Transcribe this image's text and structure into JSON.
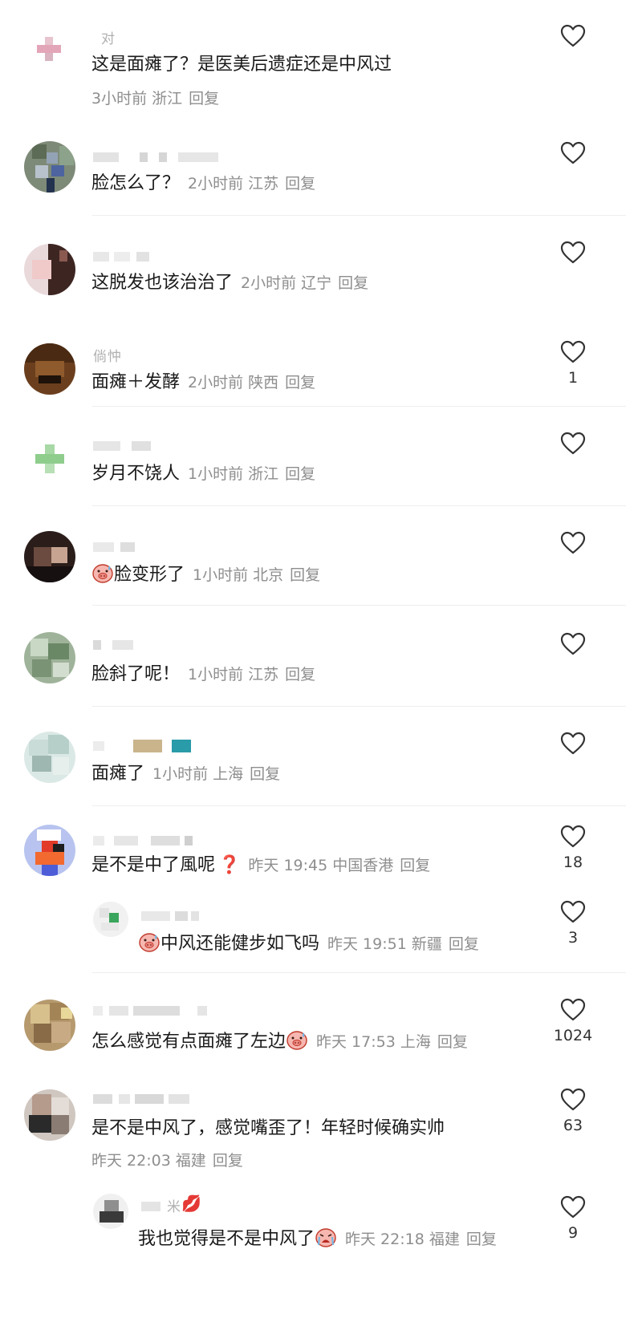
{
  "comments": [
    {
      "nick": "对",
      "text": "这是面瘫了？是医美后遗症还是中风过",
      "time": "3小时前",
      "region": "浙江",
      "reply": "回复",
      "likes": ""
    },
    {
      "nick": "",
      "text": "脸怎么了？",
      "time": "2小时前",
      "region": "江苏",
      "reply": "回复",
      "likes": ""
    },
    {
      "nick": "",
      "text": "这脱发也该治治了",
      "time": "2小时前",
      "region": "辽宁",
      "reply": "回复",
      "likes": ""
    },
    {
      "nick": "倘忡",
      "text": "面瘫＋发酵",
      "time": "2小时前",
      "region": "陕西",
      "reply": "回复",
      "likes": "1"
    },
    {
      "nick": "",
      "text": "岁月不饶人",
      "time": "1小时前",
      "region": "浙江",
      "reply": "回复",
      "likes": ""
    },
    {
      "nick": "",
      "text": "脸变形了",
      "time": "1小时前",
      "region": "北京",
      "reply": "回复",
      "likes": ""
    },
    {
      "nick": "",
      "text": "脸斜了呢！",
      "time": "1小时前",
      "region": "江苏",
      "reply": "回复",
      "likes": ""
    },
    {
      "nick": "",
      "text": "面瘫了",
      "time": "1小时前",
      "region": "上海",
      "reply": "回复",
      "likes": ""
    },
    {
      "nick": "",
      "text": "是不是中了風呢",
      "time": "昨天 19:45",
      "region": "中国香港",
      "reply": "回复",
      "likes": "18"
    },
    {
      "nick": "",
      "text": "中风还能健步如飞吗",
      "time": "昨天 19:51",
      "region": "新疆",
      "reply": "回复",
      "likes": "3"
    },
    {
      "nick": "",
      "text": "怎么感觉有点面瘫了左边",
      "time": "昨天 17:53",
      "region": "上海",
      "reply": "回复",
      "likes": "1024"
    },
    {
      "nick": "",
      "text": "是不是中风了，感觉嘴歪了！年轻时候确实帅",
      "time": "昨天 22:03",
      "region": "福建",
      "reply": "回复",
      "likes": "63"
    },
    {
      "nick": "米",
      "text": "我也觉得是不是中风了",
      "time": "昨天 22:18",
      "region": "福建",
      "reply": "回复",
      "likes": "9"
    }
  ],
  "emoji": {
    "question_mark": "❓",
    "lips": "💋"
  },
  "colors": {
    "text": "#1a1a1a",
    "meta": "#8e8e8e",
    "divider": "#eeeeee",
    "heart": "#333333"
  }
}
